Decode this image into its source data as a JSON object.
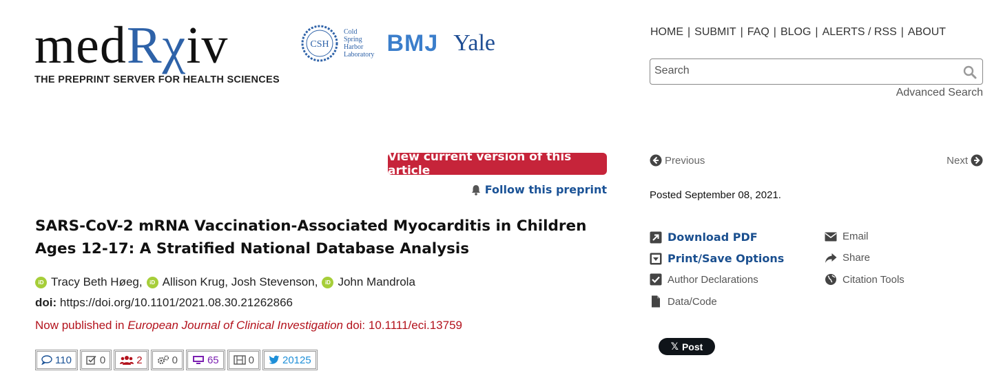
{
  "header": {
    "logo_main": "med",
    "logo_rx": "Rχ",
    "logo_tail": "iv",
    "tagline": "THE PREPRINT SERVER FOR HEALTH SCIENCES",
    "partners": {
      "csh_badge": "CSH",
      "csh_line1": "Cold",
      "csh_line2": "Spring",
      "csh_line3": "Harbor",
      "csh_line4": "Laboratory",
      "bmj": "BMJ",
      "yale": "Yale"
    }
  },
  "nav": {
    "items": [
      {
        "label": "HOME"
      },
      {
        "label": "SUBMIT"
      },
      {
        "label": "FAQ"
      },
      {
        "label": "BLOG"
      },
      {
        "label": "ALERTS / RSS"
      },
      {
        "label": "ABOUT"
      }
    ]
  },
  "search": {
    "placeholder": "Search",
    "advanced_label": "Advanced Search"
  },
  "article": {
    "current_version_label": "View current version of this article",
    "follow_label": "Follow this preprint",
    "title": "SARS-CoV-2 mRNA Vaccination-Associated Myocarditis in Children Ages 12-17: A Stratified National Database Analysis",
    "authors": [
      {
        "name": "Tracy Beth Høeg",
        "orcid": true,
        "suffix": ","
      },
      {
        "name": "Allison Krug, Josh Stevenson,",
        "orcid": true,
        "suffix": ""
      },
      {
        "name": "John Mandrola",
        "orcid": true,
        "suffix": ""
      }
    ],
    "doi_label": "doi:",
    "doi_value": "https://doi.org/10.1101/2021.08.30.21262866",
    "published_prefix": "Now published in ",
    "published_journal": "European Journal of Clinical Investigation",
    "published_doi": " doi: 10.1111/eci.13759"
  },
  "metrics": [
    {
      "icon": "comment-icon",
      "value": "110",
      "color": "#1a5296"
    },
    {
      "icon": "checkbox-icon",
      "value": "0",
      "color": "#555555"
    },
    {
      "icon": "users-icon",
      "value": "2",
      "color": "#b3121c"
    },
    {
      "icon": "cogs-icon",
      "value": "0",
      "color": "#555555"
    },
    {
      "icon": "monitor-icon",
      "value": "65",
      "color": "#7a1fb0"
    },
    {
      "icon": "film-icon",
      "value": "0",
      "color": "#555555"
    },
    {
      "icon": "twitter-icon",
      "value": "20125",
      "color": "#1d8fd8"
    }
  ],
  "sidebar": {
    "previous_label": "Previous",
    "next_label": "Next",
    "posted": "Posted September 08, 2021.",
    "actions": {
      "download_pdf": "Download PDF",
      "print_save": "Print/Save Options",
      "author_declarations": "Author Declarations",
      "data_code": "Data/Code",
      "email": "Email",
      "share": "Share",
      "citation_tools": "Citation Tools"
    },
    "post_button": "Post",
    "post_x": "𝕏"
  }
}
